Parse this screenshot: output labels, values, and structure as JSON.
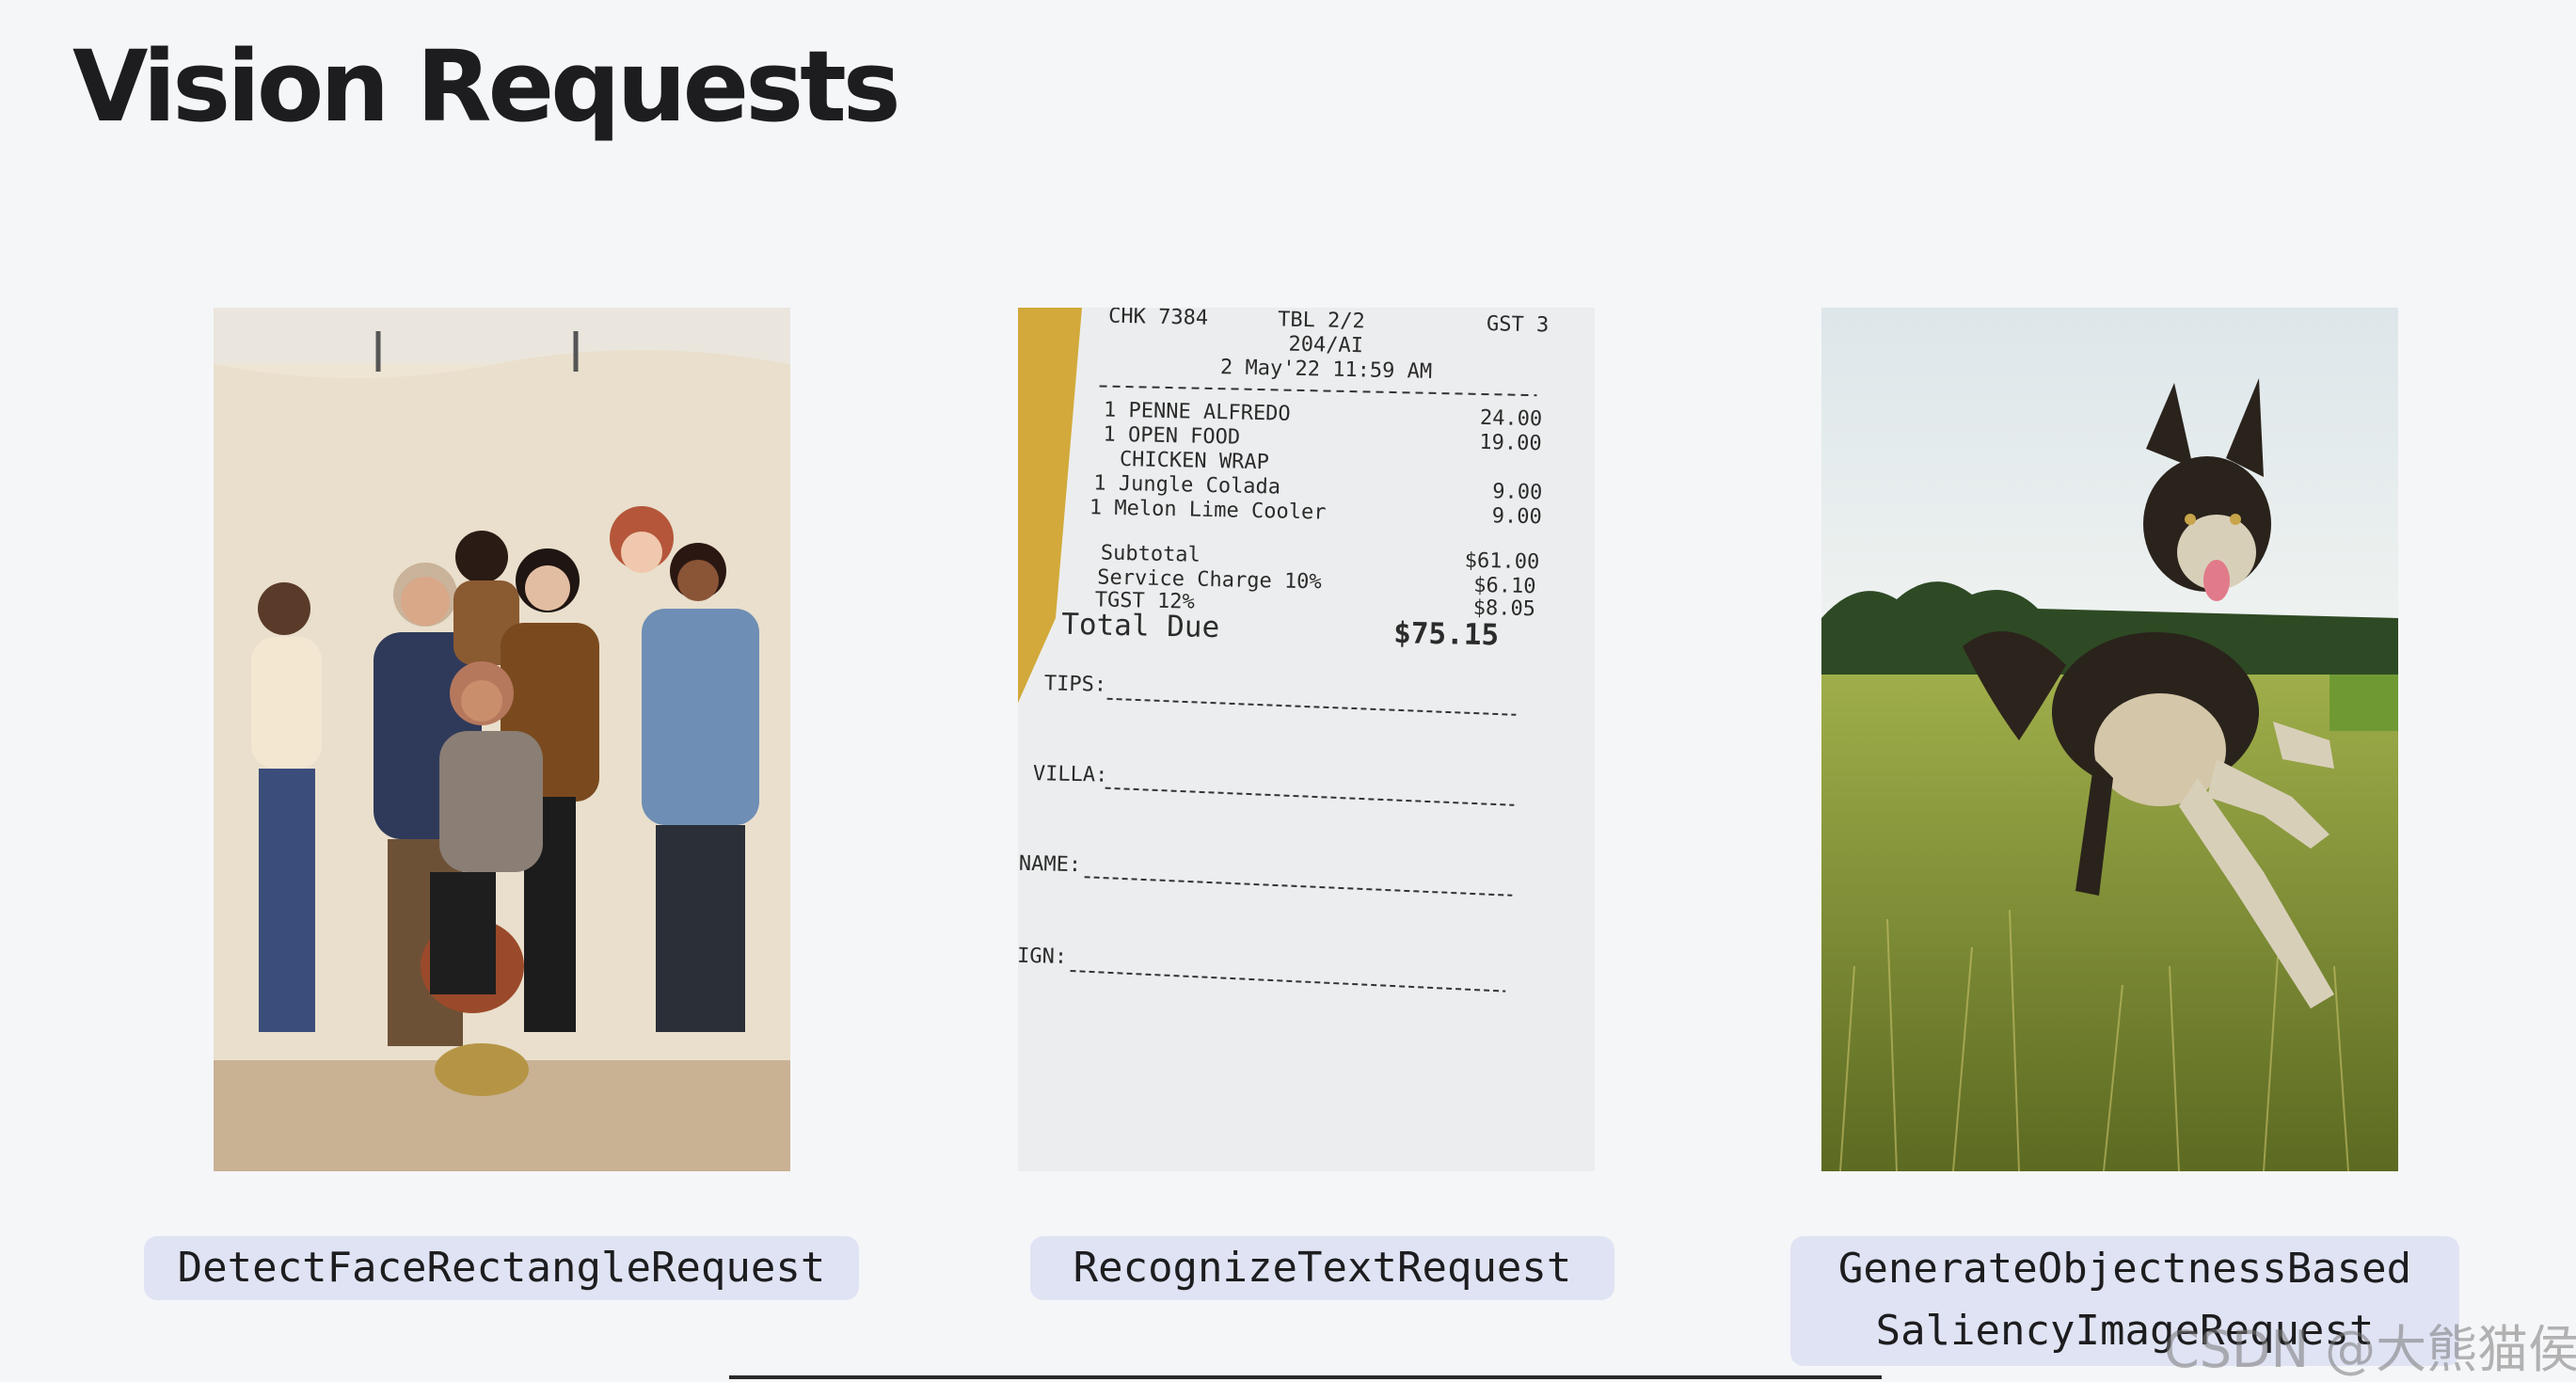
{
  "slide": {
    "title": "Vision Requests"
  },
  "examples": [
    {
      "label": "DetectFaceRectangleRequest",
      "image_icon": "group-portrait-photo"
    },
    {
      "label": "RecognizeTextRequest",
      "image_icon": "receipt-photo",
      "receipt": {
        "header_left": "CHK 7384",
        "header_mid": "TBL 2/2",
        "header_right": "GST 3",
        "header_code": "204/AI",
        "datetime": "2 May'22 11:59 AM",
        "items": [
          {
            "name": "1 PENNE ALFREDO",
            "price": "24.00"
          },
          {
            "name": "1 OPEN FOOD",
            "price": "19.00"
          },
          {
            "name": "CHICKEN WRAP",
            "price": ""
          },
          {
            "name": "1 Jungle Colada",
            "price": "9.00"
          },
          {
            "name": "1 Melon Lime Cooler",
            "price": "9.00"
          }
        ],
        "subtotal_label": "Subtotal",
        "subtotal": "$61.00",
        "service_label": "Service Charge 10%",
        "service": "$6.10",
        "tgst_label": "TGST 12%",
        "tgst": "$8.05",
        "total_label": "Total Due",
        "total": "$75.15",
        "tips": "TIPS:",
        "villa": "VILLA:",
        "name": "NAME:",
        "sign": "SIGN:"
      }
    },
    {
      "label_line1": "GenerateObjectnessBased",
      "label_line2": "SaliencyImageRequest",
      "image_icon": "dog-running-photo"
    }
  ],
  "watermark": "CSDN @大熊猫侯佩",
  "colors": {
    "background": "#f5f6f8",
    "label_bg": "#dfe3f3",
    "title": "#1d1d1f"
  }
}
